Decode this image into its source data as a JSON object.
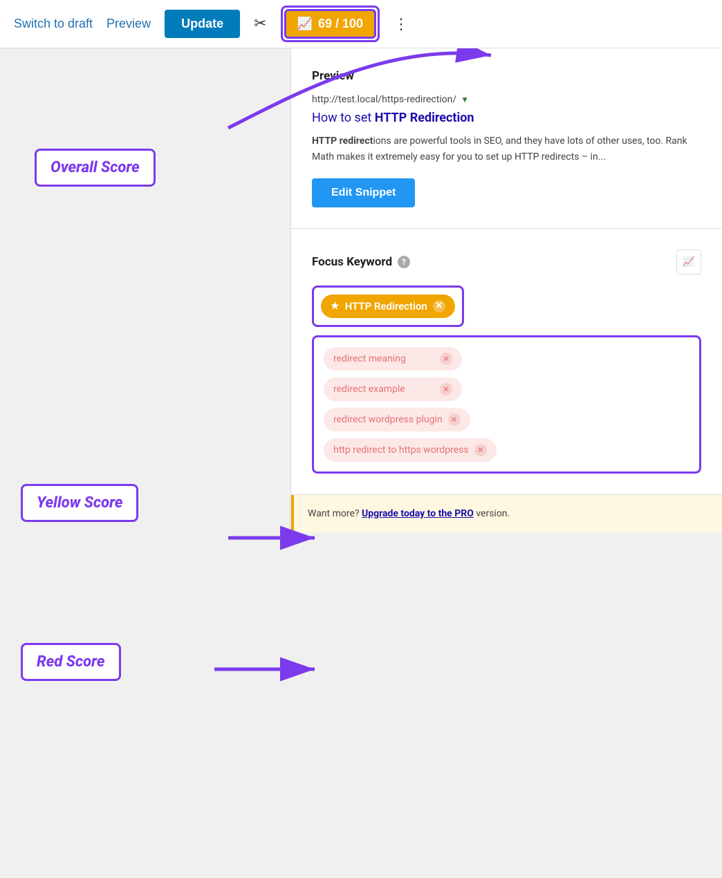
{
  "toolbar": {
    "switch_to_draft": "Switch to draft",
    "preview": "Preview",
    "update": "Update",
    "scissors_icon": "✂",
    "score": "69 / 100",
    "more_icon": "⋮",
    "chart_icon": "📈"
  },
  "annotations": {
    "overall_score": "Overall Score",
    "yellow_score": "Yellow Score",
    "red_score": "Red Score"
  },
  "preview": {
    "section_title": "Preview",
    "url": "http://test.local/https-redirection/",
    "title_start": "How to set ",
    "title_bold": "HTTP Redirection",
    "description": "HTTP redirections are powerful tools in SEO, and they have lots of other uses, too. Rank Math makes it extremely easy for you to set up HTTP redirects – in...",
    "desc_bold": "HTTP redirect",
    "desc_rest": "ions are powerful tools in SEO, and they have lots of other uses, too. Rank Math makes it extremely easy for you to set up HTTP redirects – in...",
    "edit_snippet": "Edit Snippet"
  },
  "focus_keyword": {
    "section_title": "Focus Keyword",
    "help": "?",
    "primary_keyword": "HTTP Redirection",
    "secondary_keywords": [
      "redirect meaning",
      "redirect example",
      "redirect wordpress plugin",
      "http redirect to https wordpress"
    ]
  },
  "upgrade": {
    "text_before": "Want more? ",
    "link": "Upgrade today to the PRO",
    "text_after": " version."
  }
}
